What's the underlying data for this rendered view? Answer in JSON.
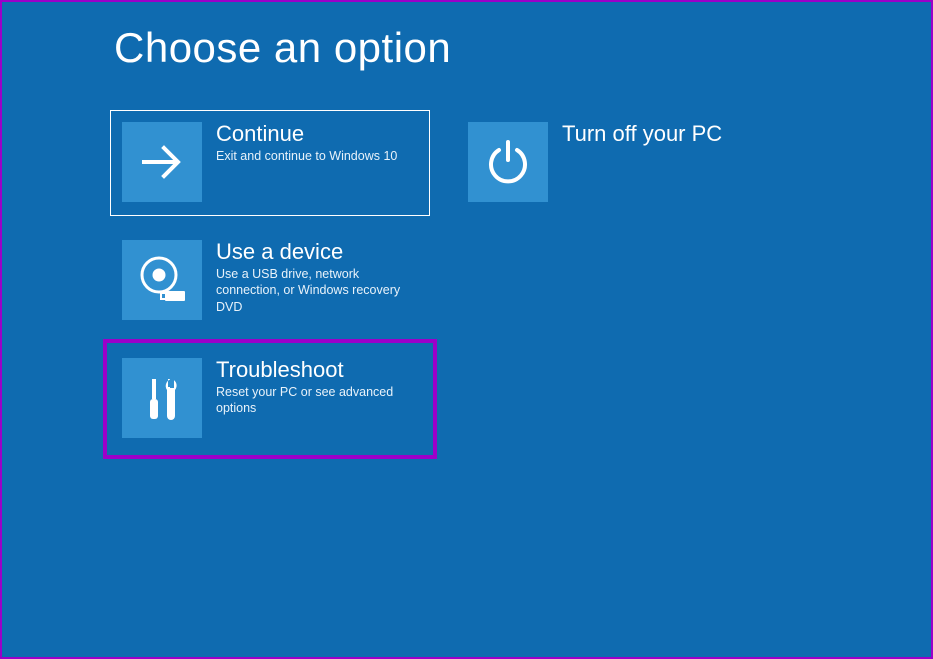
{
  "page": {
    "title": "Choose an option"
  },
  "tiles": {
    "continue": {
      "title": "Continue",
      "desc": "Exit and continue to Windows 10",
      "icon": "arrow-right-icon"
    },
    "turnoff": {
      "title": "Turn off your PC",
      "desc": "",
      "icon": "power-icon"
    },
    "device": {
      "title": "Use a device",
      "desc": "Use a USB drive, network connection, or Windows recovery DVD",
      "icon": "disc-usb-icon"
    },
    "troubleshoot": {
      "title": "Troubleshoot",
      "desc": "Reset your PC or see advanced options",
      "icon": "tools-icon"
    }
  },
  "colors": {
    "background": "#0f6bb0",
    "tile_icon_bg": "#3191d1",
    "highlight": "#9b00c9"
  }
}
